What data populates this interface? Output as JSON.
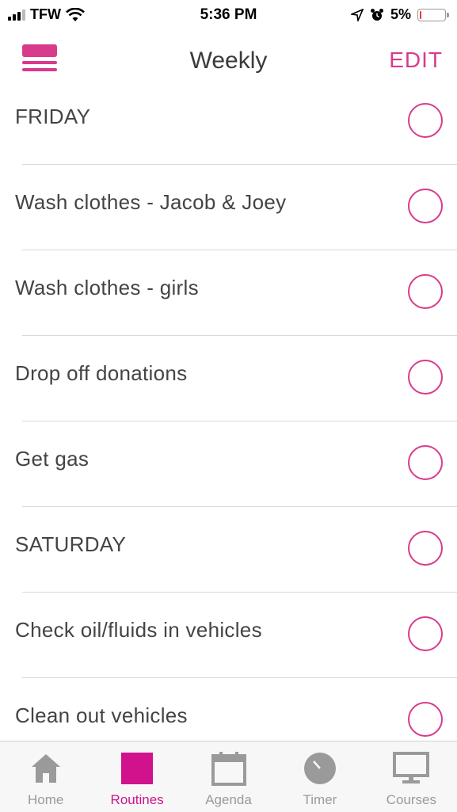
{
  "status_bar": {
    "carrier": "TFW",
    "time": "5:36 PM",
    "battery": "5%",
    "battery_level": 0.05,
    "icons": [
      "signal-icon",
      "wifi-icon",
      "location-icon",
      "alarm-icon",
      "battery-icon"
    ]
  },
  "header": {
    "title": "Weekly",
    "edit_label": "EDIT",
    "menu_icon": "hamburger-menu-icon"
  },
  "colors": {
    "accent": "#d83b8c",
    "tab_active": "#d0138c",
    "tab_inactive": "#9a9a9a",
    "text": "#444444",
    "separator": "#d9d9d9"
  },
  "routines": [
    {
      "label": "FRIDAY",
      "checked": false
    },
    {
      "label": "Wash clothes - Jacob & Joey",
      "checked": false
    },
    {
      "label": "Wash clothes - girls",
      "checked": false
    },
    {
      "label": "Drop off donations",
      "checked": false
    },
    {
      "label": "Get gas",
      "checked": false
    },
    {
      "label": "SATURDAY",
      "checked": false
    },
    {
      "label": "Check oil/fluids in vehicles",
      "checked": false
    },
    {
      "label": "Clean out vehicles",
      "checked": false
    }
  ],
  "tabs": [
    {
      "label": "Home",
      "icon": "home-icon",
      "active": false
    },
    {
      "label": "Routines",
      "icon": "routines-icon",
      "active": true
    },
    {
      "label": "Agenda",
      "icon": "calendar-icon",
      "active": false
    },
    {
      "label": "Timer",
      "icon": "timer-icon",
      "active": false
    },
    {
      "label": "Courses",
      "icon": "monitor-icon",
      "active": false
    }
  ]
}
